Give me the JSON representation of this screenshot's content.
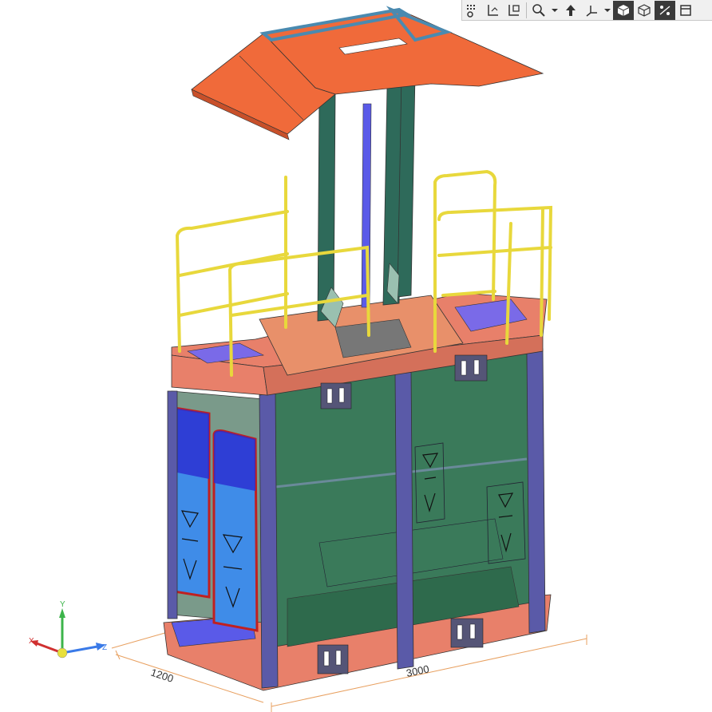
{
  "toolbar": {
    "buttons": [
      {
        "icon": "grid-settings-icon"
      },
      {
        "icon": "sketch-plane-icon"
      },
      {
        "icon": "view-snapshot-icon"
      },
      {
        "icon": "zoom-icon",
        "dropdown": true
      },
      {
        "icon": "normal-view-icon"
      },
      {
        "icon": "axis-orient-icon",
        "dropdown": true
      },
      {
        "icon": "shaded-view-icon",
        "active": true
      },
      {
        "icon": "wireframe-view-icon"
      },
      {
        "icon": "section-view-icon",
        "active": true
      },
      {
        "icon": "window-icon"
      }
    ]
  },
  "dimensions": {
    "width_label": "3000",
    "depth_label": "1200"
  },
  "triad": {
    "x": "X",
    "y": "Y",
    "z": "Z"
  },
  "colors": {
    "canopy": "#f06a3a",
    "body_frame": "#e8806a",
    "interior": "#3a7a5a",
    "door": "#3f8ce8",
    "railing": "#e8d83c",
    "column": "#5a5aa8",
    "dimension": "#e8a060"
  }
}
